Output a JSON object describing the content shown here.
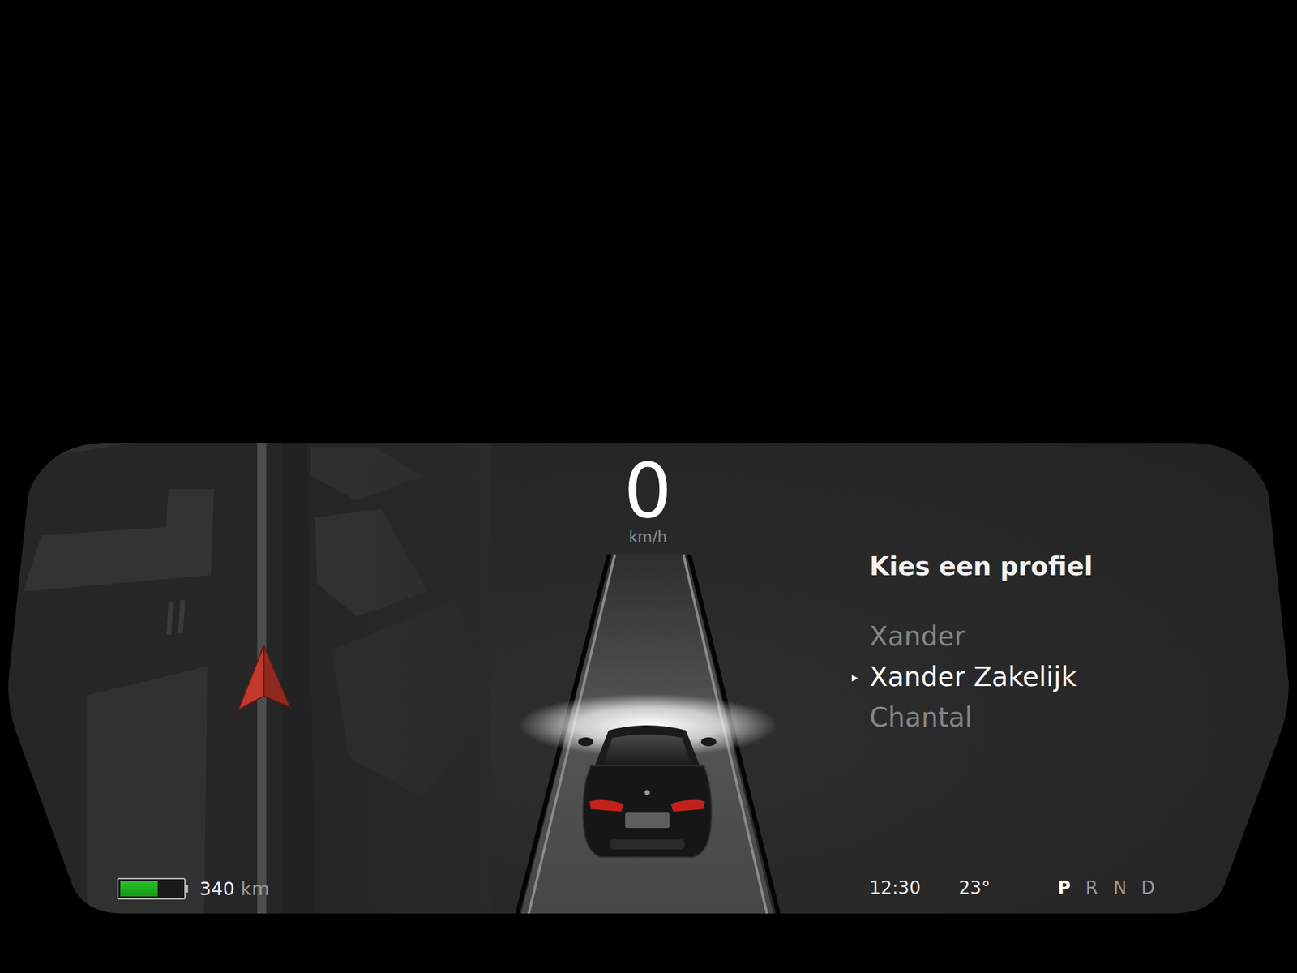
{
  "speed": {
    "value": "0",
    "unit": "km/h"
  },
  "profile_menu": {
    "title": "Kies een profiel",
    "marker": "▸",
    "profiles": [
      {
        "name": "Xander",
        "selected": false
      },
      {
        "name": "Xander Zakelijk",
        "selected": true
      },
      {
        "name": "Chantal",
        "selected": false
      }
    ]
  },
  "battery": {
    "level": 0.6,
    "range": "340",
    "unit": "km"
  },
  "status": {
    "time": "12:30",
    "temperature": "23°"
  },
  "gears": [
    {
      "label": "P",
      "selected": true
    },
    {
      "label": "R",
      "selected": false
    },
    {
      "label": "N",
      "selected": false
    },
    {
      "label": "D",
      "selected": false
    }
  ]
}
